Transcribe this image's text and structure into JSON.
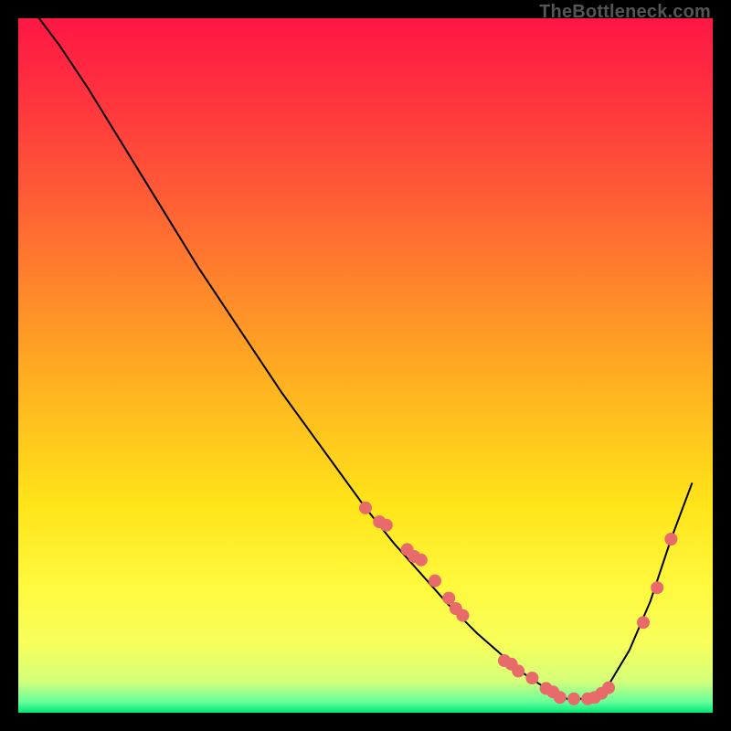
{
  "watermark": "TheBottleneck.com",
  "chart_data": {
    "type": "line",
    "title": "",
    "xlabel": "",
    "ylabel": "",
    "xlim": [
      0,
      100
    ],
    "ylim": [
      0,
      100
    ],
    "grid": false,
    "legend": false,
    "gradient_stops": [
      {
        "offset": 0.0,
        "color": "#ff1744"
      },
      {
        "offset": 0.1,
        "color": "#ff2f3f"
      },
      {
        "offset": 0.25,
        "color": "#ff5a36"
      },
      {
        "offset": 0.4,
        "color": "#ff8a2a"
      },
      {
        "offset": 0.55,
        "color": "#ffb81f"
      },
      {
        "offset": 0.7,
        "color": "#ffe419"
      },
      {
        "offset": 0.82,
        "color": "#fff93f"
      },
      {
        "offset": 0.9,
        "color": "#f7ff5a"
      },
      {
        "offset": 0.955,
        "color": "#d4ff7a"
      },
      {
        "offset": 0.985,
        "color": "#63ff9c"
      },
      {
        "offset": 1.0,
        "color": "#00e676"
      }
    ],
    "series": [
      {
        "name": "curve",
        "type": "line",
        "color": "#000000",
        "width": 2,
        "x": [
          3,
          6,
          10,
          14,
          18,
          22,
          26,
          30,
          34,
          38,
          42,
          46,
          50,
          54,
          58,
          62,
          66,
          70,
          73,
          76,
          79,
          82,
          85,
          88,
          91,
          94,
          97
        ],
        "y": [
          100,
          96,
          90,
          83.5,
          77,
          70.5,
          64,
          58,
          52,
          46,
          40.5,
          35,
          29.5,
          24.5,
          20,
          15.5,
          11.5,
          8,
          5.5,
          3.5,
          2,
          2,
          4,
          9,
          16,
          25,
          33
        ]
      },
      {
        "name": "points-left",
        "type": "scatter",
        "color": "#e96a6a",
        "radius": 7,
        "x": [
          50,
          52,
          53,
          56,
          57,
          58,
          60,
          62,
          63,
          64,
          70,
          71,
          72,
          74,
          76,
          77
        ],
        "y": [
          29.5,
          27.5,
          27,
          23.5,
          22.5,
          22,
          19,
          16.5,
          15,
          14,
          7.5,
          7,
          6,
          5,
          3.5,
          3
        ]
      },
      {
        "name": "points-bottom",
        "type": "scatter",
        "color": "#e96a6a",
        "radius": 7,
        "x": [
          78,
          80,
          82,
          83,
          84,
          85
        ],
        "y": [
          2.2,
          2,
          2,
          2.2,
          2.8,
          3.6
        ]
      },
      {
        "name": "points-right",
        "type": "scatter",
        "color": "#e96a6a",
        "radius": 7,
        "x": [
          90,
          92,
          94
        ],
        "y": [
          13,
          18,
          25
        ]
      }
    ]
  }
}
